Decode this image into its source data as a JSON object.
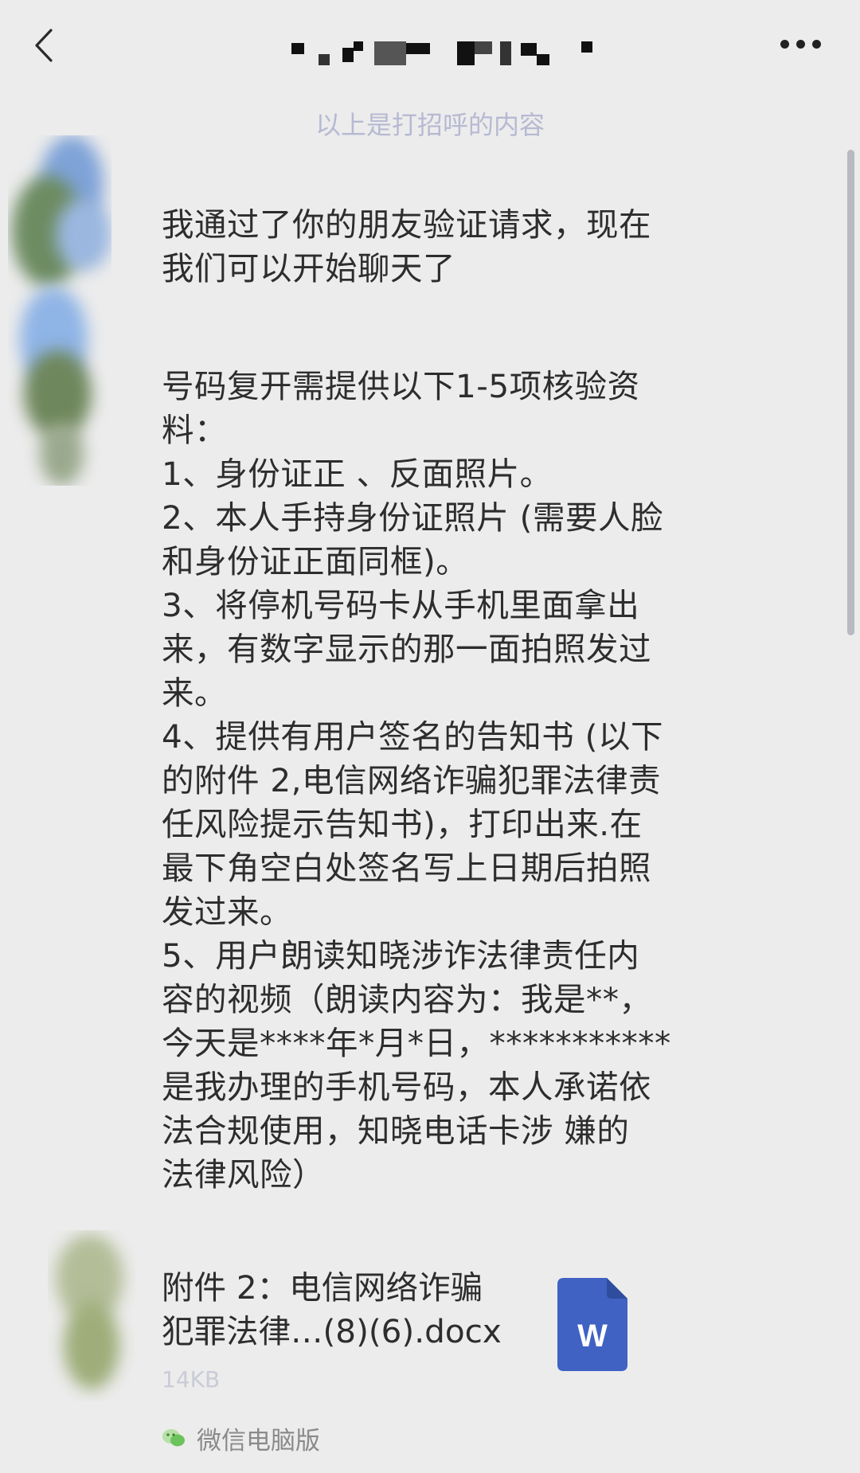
{
  "header": {
    "back_icon": "chevron-left-icon",
    "title_redacted": true,
    "more_icon": "more-dots-icon"
  },
  "system_notice": "以上是打招呼的内容",
  "messages": [
    {
      "text": "我通过了你的朋友验证请求，现在\n我们可以开始聊天了"
    },
    {
      "text": "号码复开需提供以下1-5项核验资\n料：\n1、身份证正 、反面照片。\n2、本人手持身份证照片 (需要人脸\n和身份证正面同框)。\n3、将停机号码卡从手机里面拿出\n来，有数字显示的那一面拍照发过\n来。\n4、提供有用户签名的告知书 (以下\n的附件 2,电信网络诈骗犯罪法律责\n任风险提示告知书)，打印出来.在\n最下角空白处签名写上日期后拍照\n发过来。\n5、用户朗读知晓涉诈法律责任内\n容的视频（朗读内容为：我是**，\n今天是****年*月*日，***********\n是我办理的手机号码，本人承诺依\n法合规使用，知晓电话卡涉 嫌的\n法律风险）"
    }
  ],
  "file": {
    "name": "附件 2：电信网络诈骗\n犯罪法律…(8)(6).docx",
    "size": "14KB",
    "icon_letter": "W",
    "icon": "word-document-icon",
    "icon_color": "#3f62c3"
  },
  "source": {
    "icon": "wechat-icon",
    "label": "微信电脑版",
    "icon_color": "#1aad19"
  }
}
